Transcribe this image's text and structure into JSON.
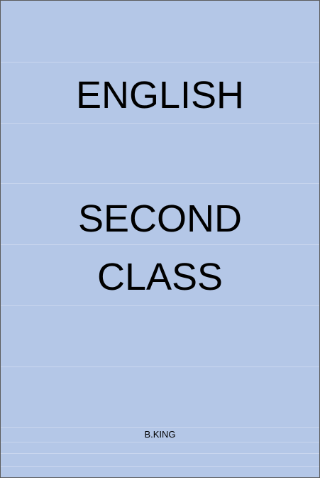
{
  "cover": {
    "subject": "ENGLISH",
    "level_line_1": "SECOND",
    "level_line_2": "CLASS",
    "author": "B.KING"
  },
  "colors": {
    "background": "#b4c7e7",
    "text": "#000000",
    "border": "#5b5b5b",
    "rule_lines": "#c9d6ee"
  }
}
